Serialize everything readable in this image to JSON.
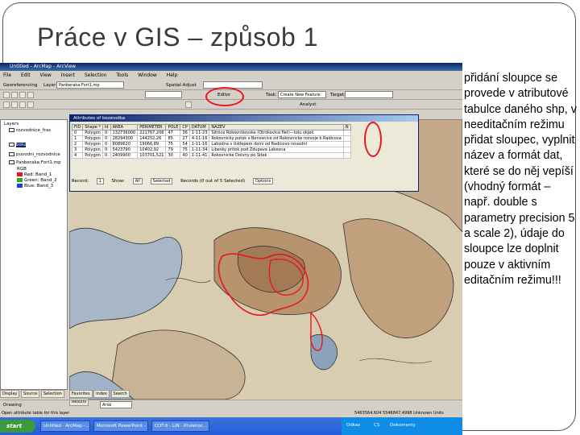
{
  "slide": {
    "title": "Práce v GIS – způsob 1",
    "body": "přidání sloupce se provede v atributové tabulce daného shp, v needitačním režimu přidat sloupec, vyplnit název a formát dat, které se do něj vepíší (vhodný formát – např. double s parametry precision 5 a scale 2), údaje do sloupce lze doplnit pouze v aktivním editačním režimu!!!"
  },
  "app": {
    "window_title": "Untitled - ArcMap - ArcView",
    "menu": [
      "File",
      "Edit",
      "View",
      "Insert",
      "Selection",
      "Tools",
      "Window",
      "Help"
    ],
    "toolbar1": {
      "georef_label": "Georeferencing",
      "layer_label": "Layer:",
      "layer_value": "Panberaka:Fort1.mp",
      "spatial_adjust_label": "Spatial Adjust"
    },
    "toolbar2": {
      "editor_label": "Editor",
      "task_label": "Task:",
      "task_value": "Create New Feature",
      "target_label": "Target:",
      "analyst_label": "Analyst"
    }
  },
  "toc": {
    "header": "Layers",
    "items": [
      {
        "label": "rozvodnice_fras"
      },
      {
        "label": "bolu"
      },
      {
        "label": "puvodni_rozvodnice"
      },
      {
        "label": "Panberaka:Fort1.mp"
      },
      {
        "label": "RGB"
      },
      {
        "label": "Red: Band_1",
        "color": "#e8171d"
      },
      {
        "label": "Green: Band_2",
        "color": "#2fa62f"
      },
      {
        "label": "Blue: Band_3",
        "color": "#1f3fd6"
      }
    ],
    "tabs": [
      "Display",
      "Source",
      "Selection"
    ],
    "tabs2": [
      "Favorites",
      "Index",
      "Search",
      "Results"
    ]
  },
  "attributes": {
    "title": "Attributes of bezevolba",
    "columns": [
      "FID",
      "Shape *",
      "Id",
      "AREA",
      "PERIMETER",
      "POLE",
      "CP",
      "DATUM",
      "NAZEV",
      "N"
    ],
    "rows": [
      [
        "0",
        "Polygon",
        "0",
        "132736000",
        "221767,206",
        "47",
        "36",
        "1-11-23",
        "Sitnice Rokovnikovske (Otrokovice flet)—tolu okjek",
        ""
      ],
      [
        "1",
        "Polygon",
        "0",
        "28294300",
        "144252,26",
        "85",
        "27",
        "4-11-16",
        "Rokovnicky potok s Benosnice od Rokovnicke rozvoje k Radicova",
        ""
      ],
      [
        "2",
        "Polygon",
        "0",
        "8089620",
        "19066,89",
        "75",
        "54",
        "1-11-16",
        "Labodna s Ustlepem dolni od Radicovo novodni",
        ""
      ],
      [
        "3",
        "Polygon",
        "0",
        "5423790",
        "10402,92",
        "79",
        "75",
        "1-11-34",
        "Libesky pritok pod Zdupava Labesna",
        ""
      ],
      [
        "4",
        "Polygon",
        "0",
        "2409900",
        "103701,521",
        "30",
        "40",
        "1-11-41",
        "Rokovnicke Dolvny po Sitek",
        ""
      ]
    ],
    "footer": {
      "record_label": "Record:",
      "record_value": "1",
      "show_label": "Show:",
      "show_all": "All",
      "show_selected": "Selected",
      "records_text": "Records (0 out of 5 Selected)",
      "options": "Options"
    }
  },
  "status": {
    "hint": "Open attribute table for this layer",
    "coords": "5463564.604  5546847,4998 Unknown Units"
  },
  "taskbar": {
    "start": "start",
    "items": [
      "Untitled - ArcMap - ...",
      "Microsoft PowerPoint - [...",
      "CDT-0 - LIN - Prulenoc..."
    ],
    "tray_lang": "CS",
    "tray_label": "Dokumenty",
    "tray_time": "Odkaz"
  },
  "drawing_toolbar": {
    "drawing_label": "Drawing",
    "font_label": "Arial"
  },
  "colors": {
    "red_highlight": "#e8171d",
    "title_bar": "#0a246a",
    "taskbar": "#245edb"
  }
}
